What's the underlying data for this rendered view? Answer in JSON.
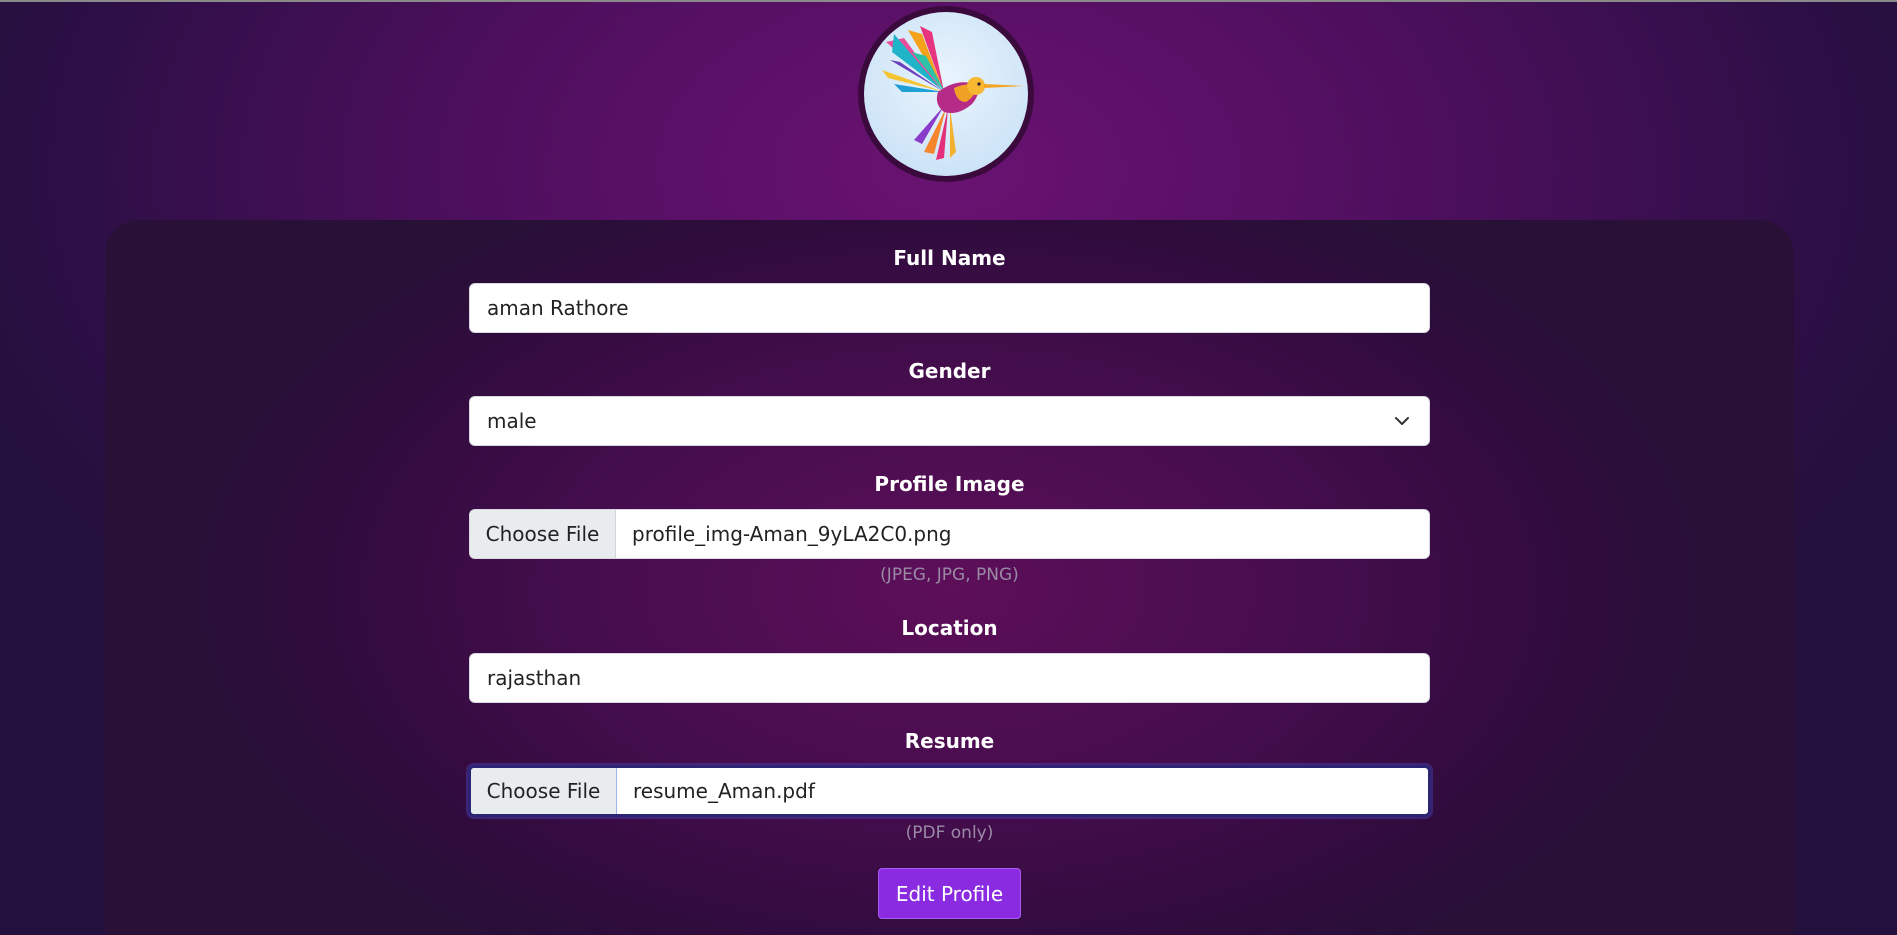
{
  "profile": {
    "avatar_alt": "hummingbird-logo"
  },
  "form": {
    "full_name": {
      "label": "Full Name",
      "value": "aman Rathore"
    },
    "gender": {
      "label": "Gender",
      "value": "male"
    },
    "profile_image": {
      "label": "Profile Image",
      "button": "Choose File",
      "file": "profile_img-Aman_9yLA2C0.png",
      "hint": "(JPEG, JPG, PNG)"
    },
    "location": {
      "label": "Location",
      "value": "rajasthan"
    },
    "resume": {
      "label": "Resume",
      "button": "Choose File",
      "file": "resume_Aman.pdf",
      "hint": "(PDF only)"
    },
    "submit_label": "Edit Profile"
  },
  "colors": {
    "accent": "#8a2be2",
    "background": "#4e0f5e",
    "card": "#3a0d45"
  },
  "icons": {
    "gender_dropdown": "chevron-down-icon"
  }
}
